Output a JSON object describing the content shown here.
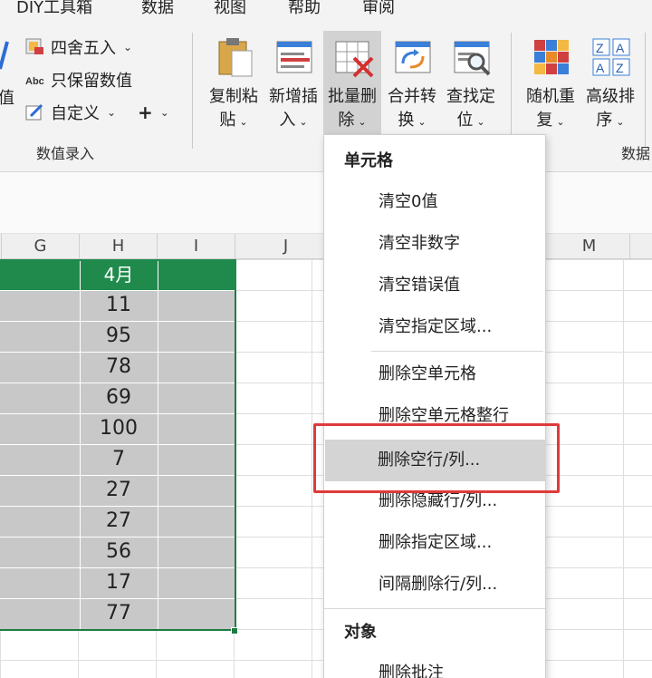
{
  "menu_tabs": [
    "DIY工具箱",
    "数据",
    "视图",
    "帮助",
    "审阅"
  ],
  "ribbon": {
    "left_cut_text": "值",
    "small_buttons": [
      {
        "label": "四舍五入",
        "icon": "round-icon"
      },
      {
        "label": "只保留数值",
        "icon": "abc-icon"
      },
      {
        "label": "自定义",
        "icon": "custom-edit-icon"
      }
    ],
    "plus_symbol": "+",
    "group_label_entry": "数值录入",
    "big_buttons": [
      {
        "line1": "复制粘",
        "line2": "贴",
        "icon": "clipboard-icon"
      },
      {
        "line1": "新增插",
        "line2": "入",
        "icon": "insert-icon"
      },
      {
        "line1": "批量删",
        "line2": "除",
        "icon": "batch-delete-icon",
        "active": true
      },
      {
        "line1": "合并转",
        "line2": "换",
        "icon": "merge-convert-icon"
      },
      {
        "line1": "查找定",
        "line2": "位",
        "icon": "find-locate-icon"
      },
      {
        "line1": "随机重",
        "line2": "复",
        "icon": "random-repeat-icon"
      },
      {
        "line1": "高级排",
        "line2": "序",
        "icon": "sort-az-icon"
      }
    ],
    "group_label_right": "数据"
  },
  "sheet": {
    "column_headers": [
      "G",
      "H",
      "I",
      "J",
      "M"
    ],
    "header_cell": "4月",
    "values": [
      "11",
      "95",
      "78",
      "69",
      "100",
      "7",
      "27",
      "27",
      "56",
      "17",
      "77"
    ]
  },
  "dropdown": {
    "sections": [
      {
        "title": "单元格",
        "items": [
          "清空0值",
          "清空非数字",
          "清空错误值",
          "清空指定区域...",
          "删除空单元格",
          "删除空单元格整行",
          "删除空行/列...",
          "删除隐藏行/列...",
          "删除指定区域...",
          "间隔删除行/列..."
        ]
      },
      {
        "title": "对象",
        "items": [
          "删除批注"
        ]
      }
    ],
    "highlighted_item": "删除空行/列..."
  },
  "colors": {
    "header_fill": "#1f8a4c",
    "selection_border": "#1e7b43",
    "highlight_box": "#e03a3a",
    "selected_cells": "#c8c8c8"
  }
}
